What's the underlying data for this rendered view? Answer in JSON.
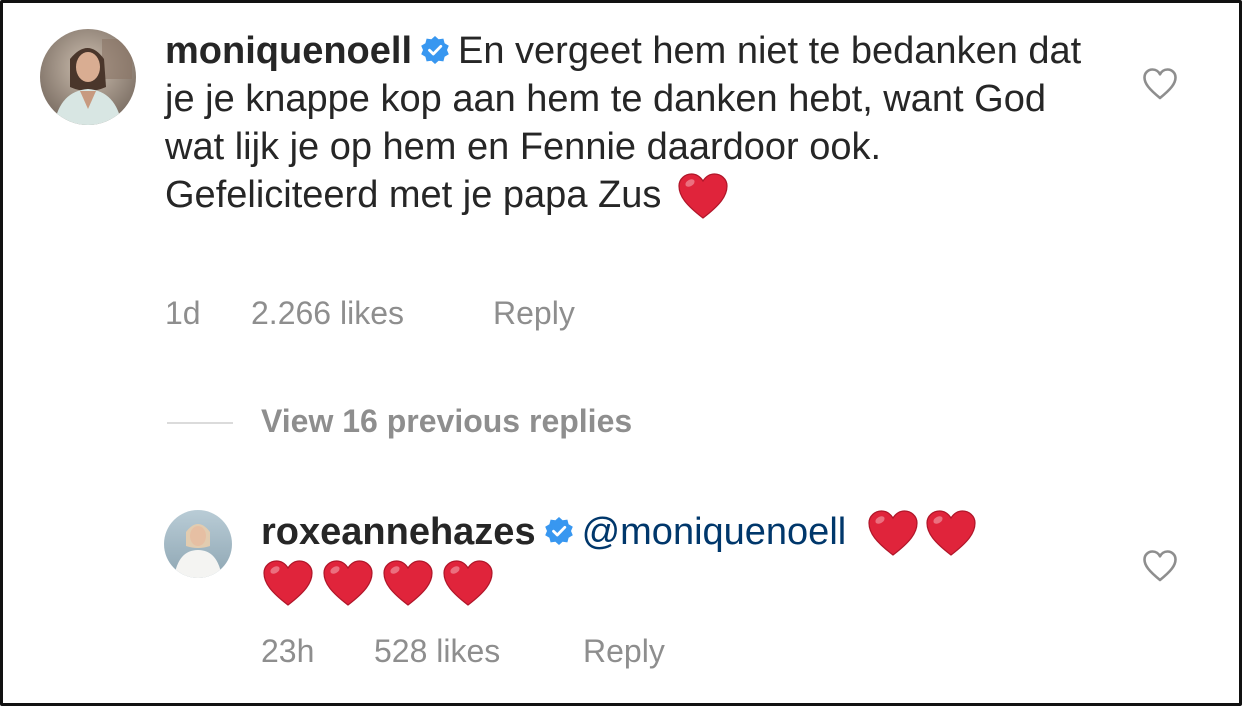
{
  "comments": [
    {
      "username": "moniquenoell",
      "verified": true,
      "avatar_icon": "profile-photo-woman-blazer",
      "text": "En vergeet hem niet te bedanken dat je je knappe kop aan hem te danken hebt, want God wat lijk je op hem en Fennie daardoor ook. Gefeliciteerd met je papa Zus",
      "emoji": "❤️",
      "time": "1d",
      "likes": "2.266 likes",
      "reply_label": "Reply",
      "like_icon": "heart-outline-icon"
    },
    {
      "username": "roxeannehazes",
      "verified": true,
      "avatar_icon": "profile-photo-woman-white-top",
      "mention": "@moniquenoell",
      "emoji_count": 6,
      "emoji": "❤️",
      "time": "23h",
      "likes": "528 likes",
      "reply_label": "Reply",
      "like_icon": "heart-outline-icon"
    }
  ],
  "view_replies": "View 16 previous replies",
  "colors": {
    "text": "#262626",
    "secondary": "#8e8e8e",
    "mention": "#00376b",
    "verified": "#3897f0",
    "heart": "#e0243b",
    "divider": "#dbdbdb"
  }
}
